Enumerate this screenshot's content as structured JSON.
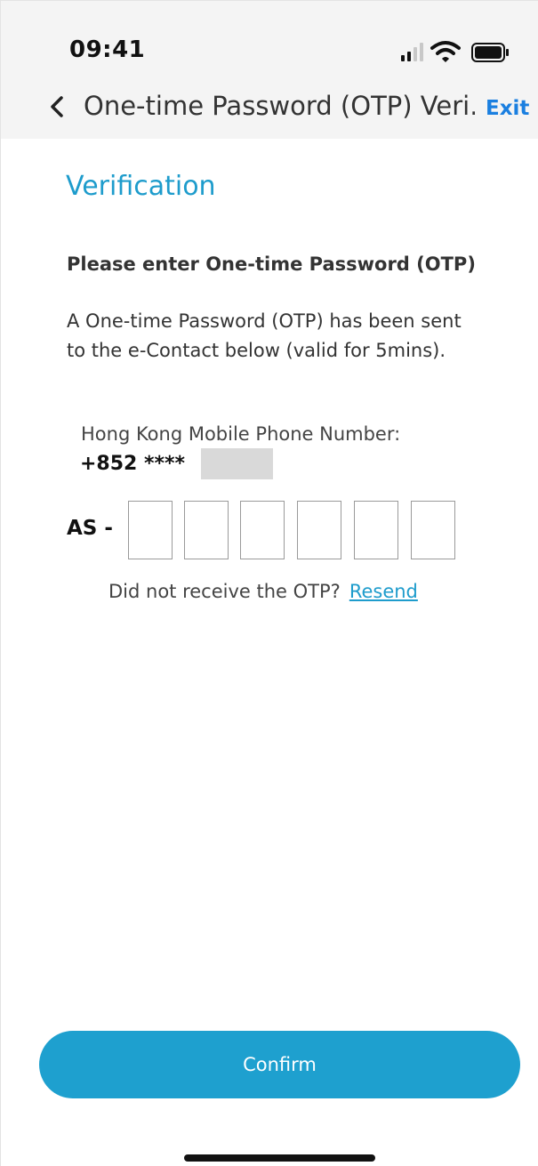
{
  "status_bar": {
    "time": "09:41",
    "icons": [
      "signal-icon",
      "wifi-icon",
      "battery-icon"
    ]
  },
  "nav": {
    "back_icon": "chevron-left-icon",
    "title": "One-time Password (OTP) Veri...",
    "exit_label": "Exit"
  },
  "page": {
    "title": "Verification",
    "heading": "Please enter One-time Password (OTP)",
    "description": "A One-time Password (OTP) has been sent to the e-Contact below (valid for 5mins).",
    "phone_label": "Hong Kong Mobile Phone Number:",
    "phone_number": "+852 ****",
    "otp_prefix": "AS -",
    "otp_digits": [
      "",
      "",
      "",
      "",
      "",
      ""
    ],
    "resend_prompt": "Did not receive the OTP?",
    "resend_label": "Resend"
  },
  "footer": {
    "confirm_label": "Confirm"
  },
  "colors": {
    "accent": "#1ea0cf",
    "link_blue": "#1a7fe0",
    "header_bg": "#f4f4f4"
  }
}
